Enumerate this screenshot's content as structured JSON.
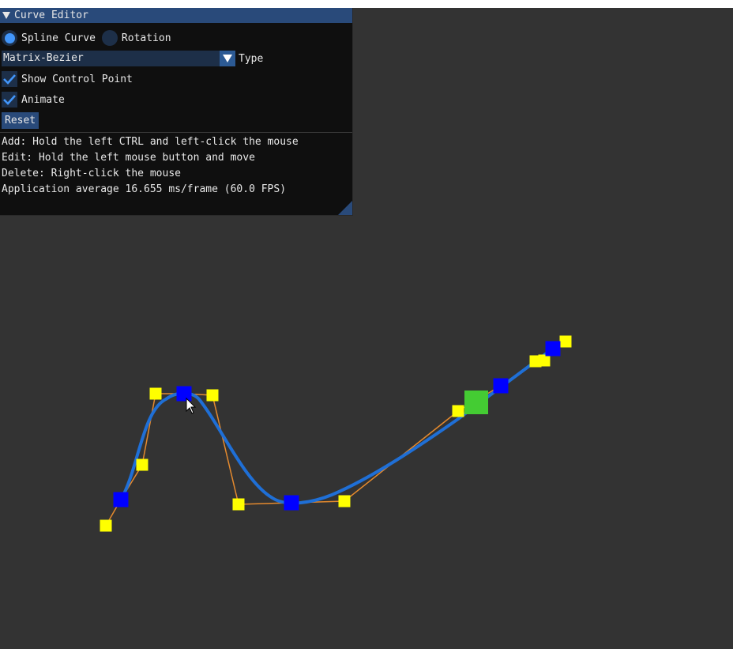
{
  "window": {
    "title": "Curve Editor"
  },
  "controls": {
    "mode_spline_label": "Spline Curve",
    "mode_rotation_label": "Rotation",
    "type_value": "Matrix-Bezier",
    "type_label": "Type",
    "show_control_point_label": "Show Control Point",
    "show_control_point_checked": true,
    "animate_label": "Animate",
    "animate_checked": true,
    "reset_label": "Reset"
  },
  "help": {
    "add": "Add: Hold the left CTRL and left-click the mouse",
    "edit": "Edit: Hold the left mouse button and move",
    "delete": "Delete: Right-click the mouse",
    "fps": "Application average 16.655 ms/frame (60.0 FPS)"
  },
  "colors": {
    "background": "#333333",
    "curve": "#1f6fd6",
    "control_polygon": "#e58a2e",
    "anchor_point": "#0000ff",
    "handle_point": "#ffff00",
    "animated_point": "#44cc33",
    "panel_accent": "#294a7a"
  }
}
